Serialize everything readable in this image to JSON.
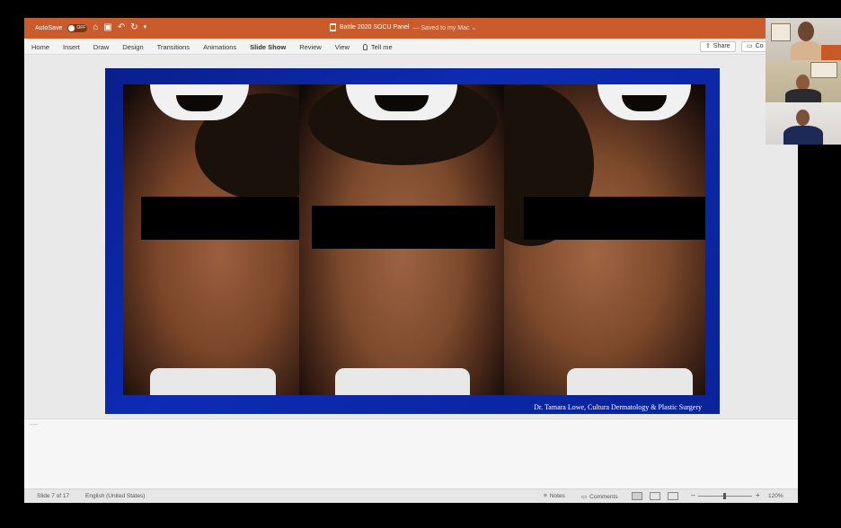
{
  "window": {
    "autosave_label": "AutoSave",
    "autosave_state": "OFF",
    "doc_title": "Battle 2020 SOCU Panel",
    "saved_status": "— Saved to my Mac ⌄"
  },
  "ribbon": {
    "tabs": [
      {
        "label": "Home"
      },
      {
        "label": "Insert"
      },
      {
        "label": "Draw"
      },
      {
        "label": "Design"
      },
      {
        "label": "Transitions"
      },
      {
        "label": "Animations"
      },
      {
        "label": "Slide Show"
      },
      {
        "label": "Review"
      },
      {
        "label": "View"
      }
    ],
    "tell_me": "Tell me",
    "share_label": "Share",
    "comments_label": "Co"
  },
  "slide": {
    "credit": "Dr. Tamara Lowe, Cultura Dermatology & Plastic Surgery"
  },
  "notes": {
    "placeholder": "----"
  },
  "statusbar": {
    "slide_indicator": "Slide 7 of 17",
    "language": "English (United States)",
    "notes_label": "Notes",
    "comments_label": "Comments",
    "zoom_minus": "–",
    "zoom_plus": "+",
    "zoom_level": "120%",
    "zoom_value_percent": 120
  },
  "colors": {
    "titlebar": "#c95b2d",
    "slide_border": "#0d2bb3"
  },
  "icons": {
    "home": "home-icon",
    "save": "save-icon",
    "undo": "undo-icon",
    "redo": "redo-icon",
    "customize": "chevron-down-icon"
  }
}
